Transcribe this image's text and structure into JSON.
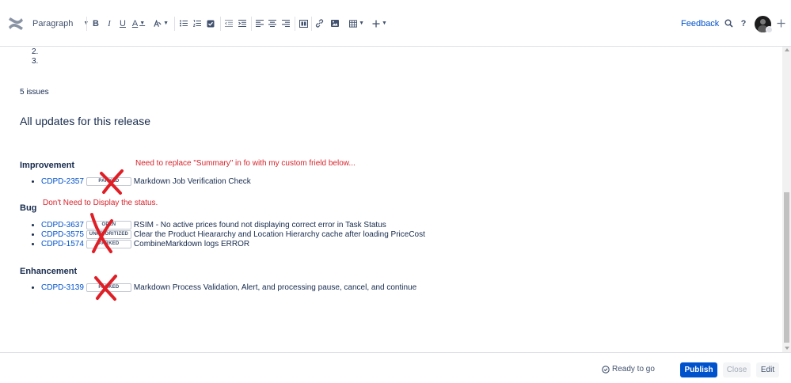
{
  "toolbar": {
    "paragraph_label": "Paragraph",
    "bold_label": "B",
    "italic_label": "I",
    "underline_label": "U",
    "text_color_label": "A",
    "feedback_label": "Feedback",
    "help_label": "?",
    "accent_color": "#0052cc"
  },
  "content": {
    "ordered_items": [
      "2.",
      "3."
    ],
    "issue_count": "5 issues",
    "heading": "All updates for this release",
    "categories": [
      {
        "name": "Improvement",
        "issues": [
          {
            "key": "CDPD-2357",
            "status": "PARKED",
            "summary": "Markdown Job Verification Check"
          }
        ]
      },
      {
        "name": "Bug",
        "issues": [
          {
            "key": "CDPD-3637",
            "status": "OPEN",
            "summary": "RSIM - No active prices found not displaying correct error in Task Status"
          },
          {
            "key": "CDPD-3575",
            "status": "UNPRIORITIZED",
            "summary": "Clear the Product Hieararchy and Location Hierarchy cache after loading PriceCost"
          },
          {
            "key": "CDPD-1574",
            "status": "PARKED",
            "summary": "CombineMarkdown logs ERROR"
          }
        ]
      },
      {
        "name": "Enhancement",
        "issues": [
          {
            "key": "CDPD-3139",
            "status": "PARKED",
            "summary": "Markdown Process Validation, Alert, and processing pause, cancel, and continue"
          }
        ]
      }
    ],
    "annotations": {
      "summary_note": "Need to replace  \"Summary\" in fo with my custom frield below...",
      "status_note": "Don't Need to Display the status.",
      "color": "#d7232b"
    }
  },
  "footer": {
    "ready_label": "Ready to go",
    "publish_label": "Publish",
    "close_label": "Close",
    "edit_label": "Edit"
  }
}
